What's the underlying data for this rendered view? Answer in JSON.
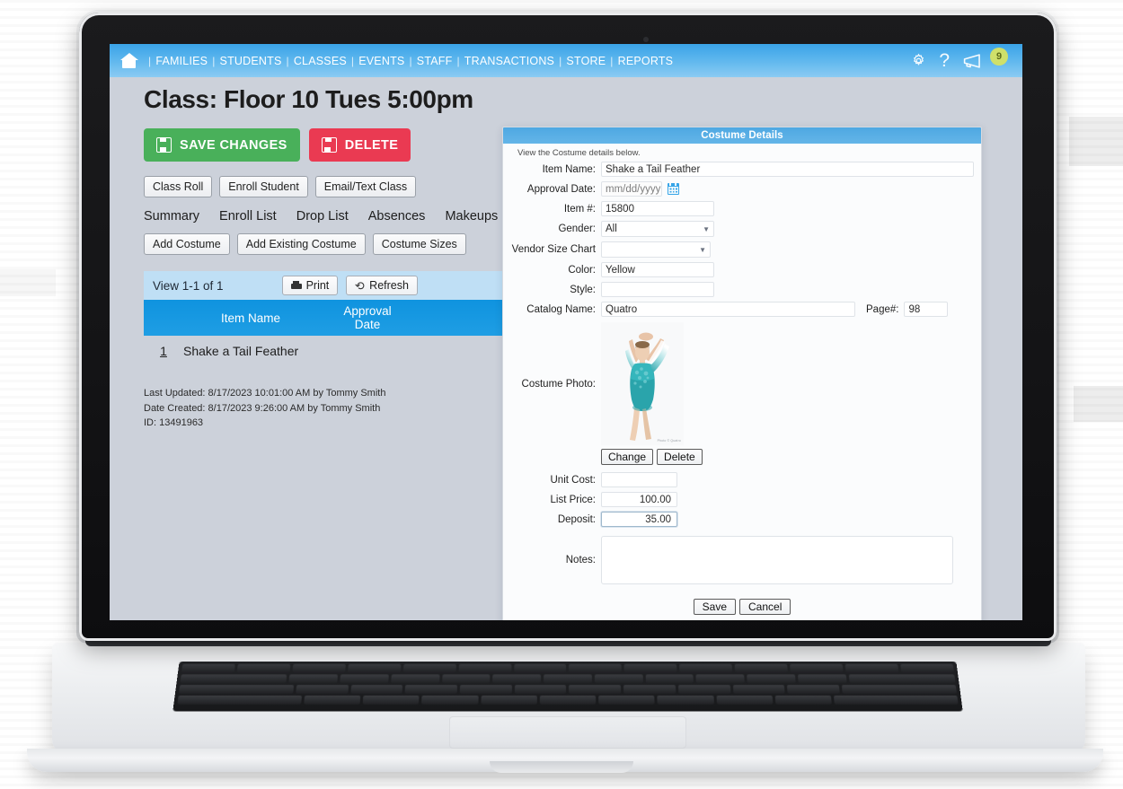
{
  "topnav": {
    "home_icon": "home-icon",
    "links": [
      "FAMILIES",
      "STUDENTS",
      "CLASSES",
      "EVENTS",
      "STAFF",
      "TRANSACTIONS",
      "STORE",
      "REPORTS"
    ],
    "separator": "|",
    "gear_icon": "gear-icon",
    "help_icon": "?",
    "megaphone_icon": "megaphone-icon",
    "notification_count": "9",
    "accent_color": "#63b9ee",
    "badge_color": "#cfe06a"
  },
  "left": {
    "page_title": "Class: Floor 10 Tues 5:00pm",
    "save_button": "SAVE CHANGES",
    "delete_button": "DELETE",
    "save_color": "#49b05a",
    "delete_color": "#ea3a52",
    "action_buttons": [
      "Class Roll",
      "Enroll Student",
      "Email/Text Class"
    ],
    "tabs": [
      "Summary",
      "Enroll List",
      "Drop List",
      "Absences",
      "Makeups"
    ],
    "costume_buttons": [
      "Add Costume",
      "Add Existing Costume",
      "Costume Sizes"
    ],
    "grid": {
      "count_label": "View 1-1 of 1",
      "print_button": "Print",
      "refresh_button": "Refresh",
      "headers": {
        "num": "",
        "item_name": "Item Name",
        "approval_date": "Approval\nDate"
      },
      "header_item_name": "Item Name",
      "header_approval_line1": "Approval",
      "header_approval_line2": "Date",
      "rows": [
        {
          "num": "1",
          "item_name": "Shake a Tail Feather",
          "approval_date": ""
        }
      ],
      "header_color": "#1f9ee4",
      "toolbar_color": "#bfdff5"
    },
    "meta": {
      "last_updated": "Last Updated: 8/17/2023 10:01:00 AM by Tommy Smith",
      "date_created": "Date Created: 8/17/2023 9:26:00 AM by Tommy Smith",
      "id": "ID: 13491963"
    }
  },
  "modal": {
    "title": "Costume Details",
    "subtitle": "View the Costume details below.",
    "fields": {
      "item_name_label": "Item Name:",
      "item_name_value": "Shake a Tail Feather",
      "approval_date_label": "Approval Date:",
      "approval_date_placeholder": "mm/dd/yyyy",
      "approval_date_value": "",
      "calendar_icon": "calendar-icon",
      "item_number_label": "Item #:",
      "item_number_value": "15800",
      "gender_label": "Gender:",
      "gender_value": "All",
      "vendor_size_chart_label": "Vendor Size Chart",
      "vendor_size_chart_value": "",
      "color_label": "Color:",
      "color_value": "Yellow",
      "style_label": "Style:",
      "style_value": "",
      "catalog_name_label": "Catalog Name:",
      "catalog_name_value": "Quatro",
      "page_number_label": "Page#:",
      "page_number_value": "98",
      "costume_photo_label": "Costume Photo:",
      "photo_credit": "Photo © Quatro",
      "photo_change_button": "Change",
      "photo_delete_button": "Delete",
      "unit_cost_label": "Unit Cost:",
      "unit_cost_value": "",
      "list_price_label": "List Price:",
      "list_price_value": "100.00",
      "deposit_label": "Deposit:",
      "deposit_value": "35.00",
      "notes_label": "Notes:",
      "notes_value": ""
    },
    "save_button": "Save",
    "cancel_button": "Cancel"
  }
}
